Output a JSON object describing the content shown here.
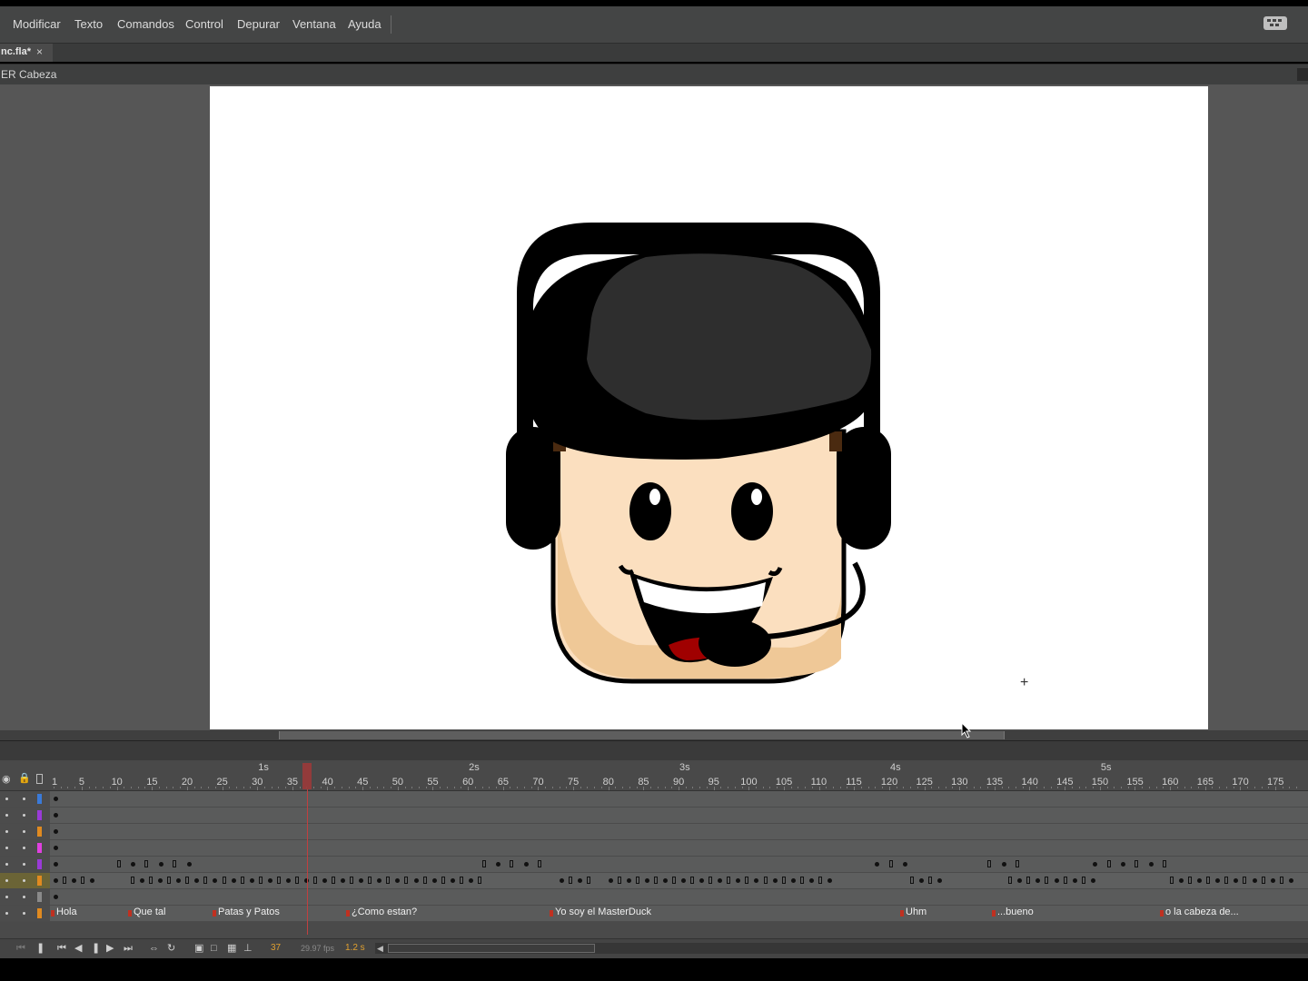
{
  "menu": {
    "items": [
      "Modificar",
      "Texto",
      "Comandos",
      "Control",
      "Depurar",
      "Ventana",
      "Ayuda"
    ]
  },
  "document": {
    "tab_label": "nc.fla*",
    "close_glyph": "×",
    "breadcrumb": "ER Cabeza"
  },
  "stage": {
    "background": "#ffffff",
    "cursor_glyph": "+"
  },
  "timeline": {
    "seconds": [
      "1s",
      "2s",
      "3s",
      "4s",
      "5s"
    ],
    "frame_numbers": [
      "1",
      "5",
      "10",
      "15",
      "20",
      "25",
      "30",
      "35",
      "40",
      "45",
      "50",
      "55",
      "60",
      "65",
      "70",
      "75",
      "80",
      "85",
      "90",
      "95",
      "100",
      "105",
      "110",
      "115",
      "120",
      "125",
      "130",
      "135",
      "140",
      "145",
      "150",
      "155",
      "160",
      "165",
      "170",
      "175"
    ],
    "current_frame_marker": 37,
    "layer_colors": [
      "#3a7ad8",
      "#9a3ad8",
      "#e08a20",
      "#e040e0",
      "#9a3ad8",
      "#e08a20",
      "#8a8a8a",
      "#e08a20"
    ],
    "active_layer_index": 5,
    "frame_labels": [
      "Hola",
      "Que tal",
      "Patas y Patos",
      "¿Como estan?",
      "Yo soy el MasterDuck",
      "Uhm",
      "...bueno",
      "o la cabeza de..."
    ],
    "status": {
      "frame": "37",
      "fps": "29.97 fps",
      "time": "1.2 s"
    }
  }
}
